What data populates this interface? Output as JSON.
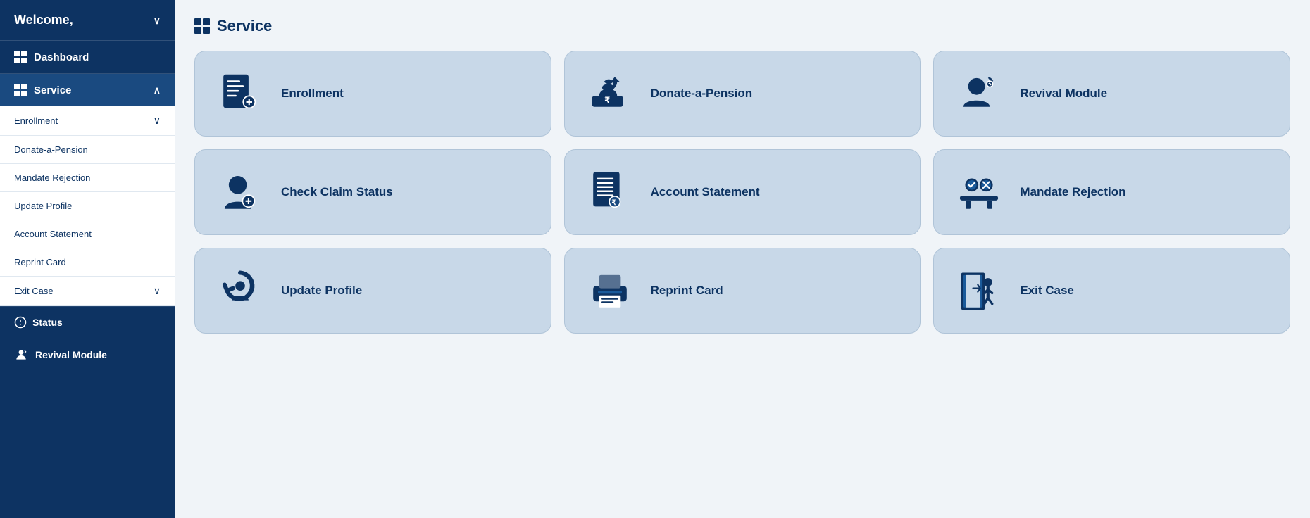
{
  "sidebar": {
    "welcome_label": "Welcome,",
    "dashboard_label": "Dashboard",
    "service_label": "Service",
    "subitems": [
      {
        "label": "Enrollment",
        "has_chevron": true
      },
      {
        "label": "Donate-a-Pension",
        "has_chevron": false
      },
      {
        "label": "Mandate Rejection",
        "has_chevron": false
      },
      {
        "label": "Update Profile",
        "has_chevron": false
      },
      {
        "label": "Account Statement",
        "has_chevron": false
      },
      {
        "label": "Reprint Card",
        "has_chevron": false
      },
      {
        "label": "Exit Case",
        "has_chevron": true
      }
    ],
    "status_label": "Status",
    "revival_label": "Revival Module"
  },
  "main": {
    "page_title": "Service",
    "cards": [
      {
        "id": "enrollment",
        "label": "Enrollment",
        "icon": "enrollment"
      },
      {
        "id": "donate-a-pension",
        "label": "Donate-a-Pension",
        "icon": "donate"
      },
      {
        "id": "revival-module",
        "label": "Revival Module",
        "icon": "revival"
      },
      {
        "id": "check-claim-status",
        "label": "Check Claim Status",
        "icon": "claim"
      },
      {
        "id": "account-statement",
        "label": "Account Statement",
        "icon": "statement"
      },
      {
        "id": "mandate-rejection",
        "label": "Mandate Rejection",
        "icon": "mandate"
      },
      {
        "id": "update-profile",
        "label": "Update Profile",
        "icon": "profile"
      },
      {
        "id": "reprint-card",
        "label": "Reprint Card",
        "icon": "reprint"
      },
      {
        "id": "exit-case",
        "label": "Exit Case",
        "icon": "exit"
      }
    ]
  }
}
